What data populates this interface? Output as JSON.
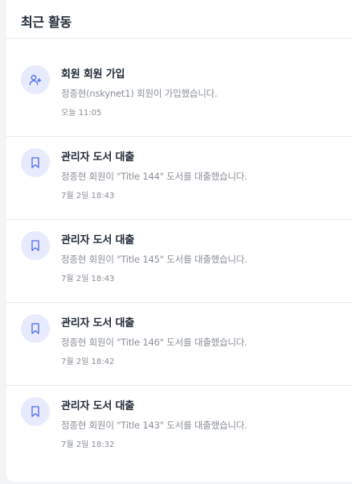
{
  "panel": {
    "title": "최근 활동"
  },
  "activities": [
    {
      "icon": "user-plus-icon",
      "title": "회원 회원 가입",
      "description": "정종현(nskynet1) 회원이 가입했습니다.",
      "time": "오늘 11:05"
    },
    {
      "icon": "bookmark-icon",
      "title": "관리자 도서 대출",
      "description": "정종현 회원이 \"Title 144\" 도서를 대출했습니다.",
      "time": "7월 2일 18:43"
    },
    {
      "icon": "bookmark-icon",
      "title": "관리자 도서 대출",
      "description": "정종현 회원이 \"Title 145\" 도서를 대출했습니다.",
      "time": "7월 2일 18:43"
    },
    {
      "icon": "bookmark-icon",
      "title": "관리자 도서 대출",
      "description": "정종현 회원이 \"Title 146\" 도서를 대출했습니다.",
      "time": "7월 2일 18:42"
    },
    {
      "icon": "bookmark-icon",
      "title": "관리자 도서 대출",
      "description": "정종현 회원이 \"Title 143\" 도서를 대출했습니다.",
      "time": "7월 2일 18:32"
    }
  ],
  "colors": {
    "icon_accent": "#4f6cf0",
    "icon_background": "#e7ebfd"
  }
}
